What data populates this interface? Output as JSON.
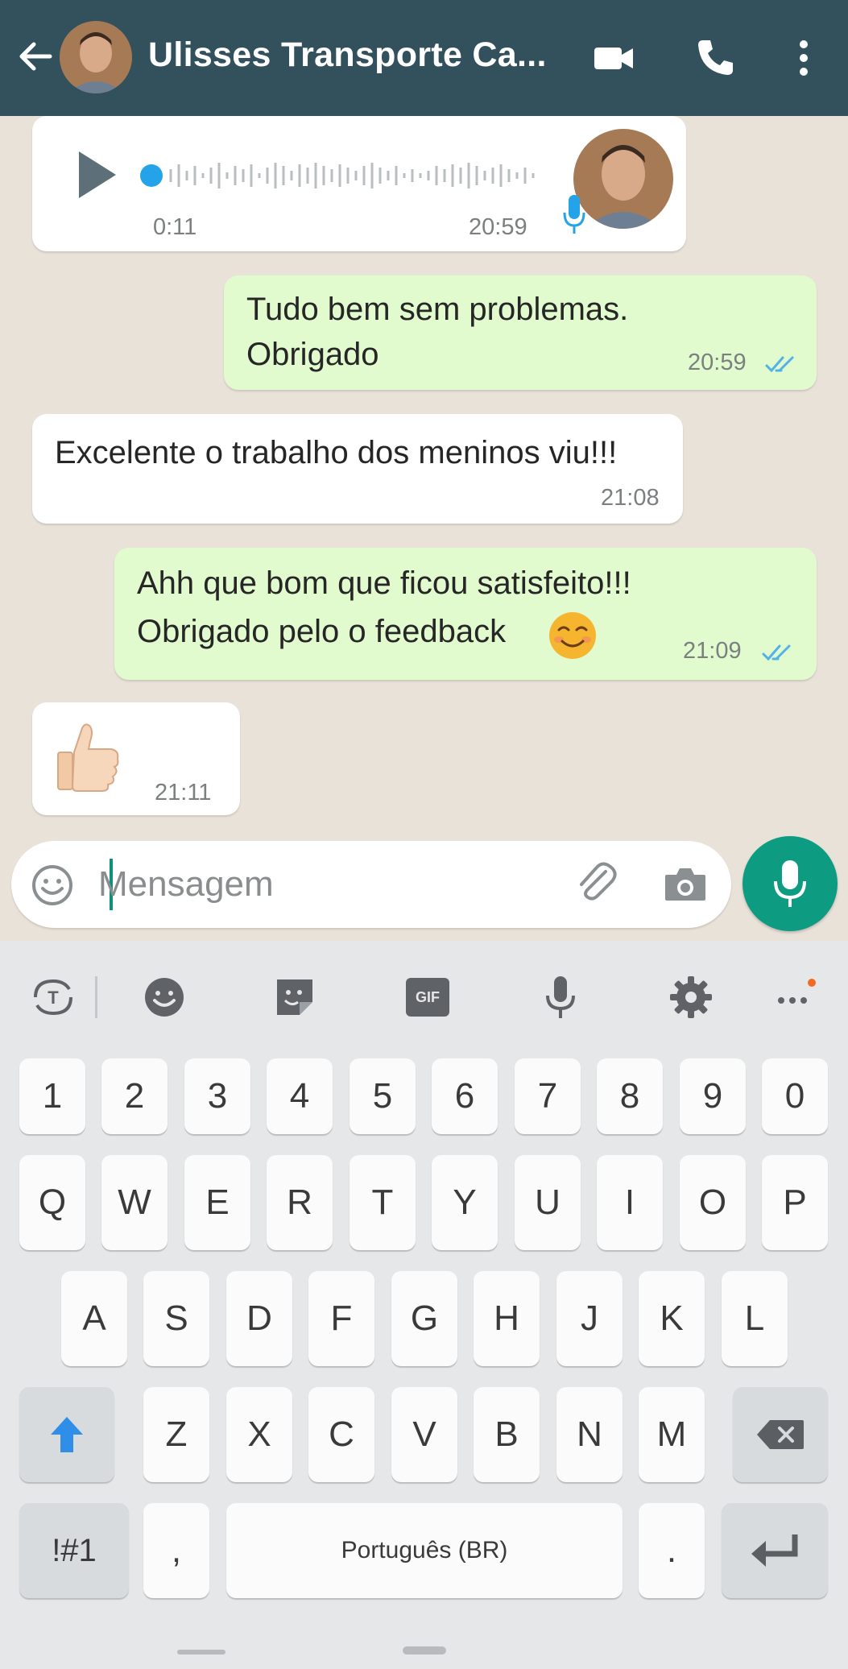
{
  "header": {
    "title": "Ulisses Transporte Ca...",
    "bg_color": "#33505d"
  },
  "messages": [
    {
      "type": "voice",
      "direction": "in",
      "duration": "0:11",
      "time": "20:59"
    },
    {
      "type": "text",
      "direction": "out",
      "lines": [
        "Tudo bem sem problemas.",
        "Obrigado"
      ],
      "time": "20:59",
      "status": "read"
    },
    {
      "type": "text",
      "direction": "in",
      "lines": [
        "Excelente o trabalho dos meninos viu!!!"
      ],
      "time": "21:08"
    },
    {
      "type": "text",
      "direction": "out",
      "lines": [
        "Ahh que bom que ficou satisfeito!!!",
        "Obrigado pelo o feedback"
      ],
      "emoji": "smiling-face",
      "time": "21:09",
      "status": "read"
    },
    {
      "type": "emoji",
      "direction": "in",
      "emoji": "thumbs-up",
      "time": "21:11"
    }
  ],
  "composer": {
    "placeholder": "Mensagem",
    "icons": [
      "emoji-icon",
      "attach-icon",
      "camera-icon"
    ],
    "send_icon": "mic-icon",
    "accent": "#0d9b82"
  },
  "keyboard": {
    "toolbar": [
      "translate-icon",
      "emoji-icon",
      "sticker-icon",
      "gif-icon",
      "voice-input-icon",
      "settings-icon",
      "more-icon"
    ],
    "gif_label": "GIF",
    "rows": {
      "numbers": [
        "1",
        "2",
        "3",
        "4",
        "5",
        "6",
        "7",
        "8",
        "9",
        "0"
      ],
      "row1": [
        "Q",
        "W",
        "E",
        "R",
        "T",
        "Y",
        "U",
        "I",
        "O",
        "P"
      ],
      "row2": [
        "A",
        "S",
        "D",
        "F",
        "G",
        "H",
        "J",
        "K",
        "L"
      ],
      "row3": [
        "Z",
        "X",
        "C",
        "V",
        "B",
        "N",
        "M"
      ]
    },
    "symbols_label": "!#1",
    "comma_label": ",",
    "space_label": "Português (BR)",
    "period_label": "."
  }
}
